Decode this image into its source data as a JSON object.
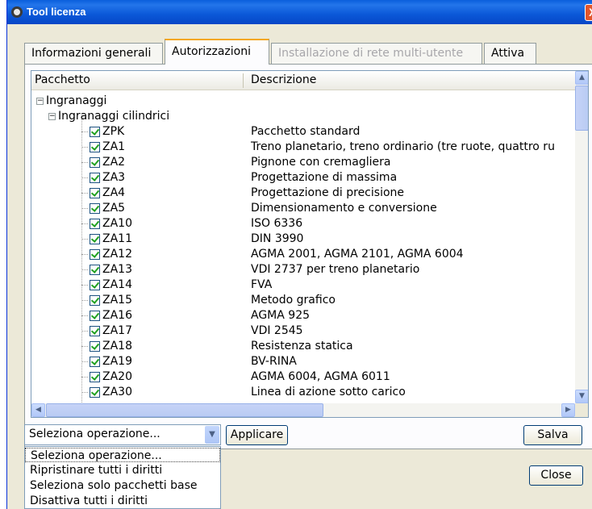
{
  "window": {
    "title": "Tool licenza",
    "close_glyph": "X"
  },
  "tabs": [
    {
      "label": "Informazioni generali",
      "state": "normal"
    },
    {
      "label": "Autorizzazioni",
      "state": "active"
    },
    {
      "label": "Installazione di rete multi-utente",
      "state": "disabled"
    },
    {
      "label": "Attiva",
      "state": "normal"
    }
  ],
  "grid": {
    "columns": [
      "Pacchetto",
      "Descrizione"
    ],
    "tree": {
      "root": "Ingranaggi",
      "child": "Ingranaggi cilindrici",
      "packages": [
        {
          "code": "ZPK",
          "description": "Pacchetto standard",
          "checked": true
        },
        {
          "code": "ZA1",
          "description": "Treno planetario, treno ordinario (tre ruote, quattro ru",
          "checked": true
        },
        {
          "code": "ZA2",
          "description": "Pignone con cremagliera",
          "checked": true
        },
        {
          "code": "ZA3",
          "description": "Progettazione di massima",
          "checked": true
        },
        {
          "code": "ZA4",
          "description": "Progettazione di precisione",
          "checked": true
        },
        {
          "code": "ZA5",
          "description": "Dimensionamento e conversione",
          "checked": true
        },
        {
          "code": "ZA10",
          "description": "ISO 6336",
          "checked": true
        },
        {
          "code": "ZA11",
          "description": "DIN 3990",
          "checked": true
        },
        {
          "code": "ZA12",
          "description": "AGMA 2001, AGMA 2101, AGMA 6004",
          "checked": true
        },
        {
          "code": "ZA13",
          "description": "VDI 2737 per treno planetario",
          "checked": true
        },
        {
          "code": "ZA14",
          "description": "FVA",
          "checked": true
        },
        {
          "code": "ZA15",
          "description": "Metodo grafico",
          "checked": true
        },
        {
          "code": "ZA16",
          "description": "AGMA 925",
          "checked": true
        },
        {
          "code": "ZA17",
          "description": "VDI 2545",
          "checked": true
        },
        {
          "code": "ZA18",
          "description": "Resistenza statica",
          "checked": true
        },
        {
          "code": "ZA19",
          "description": "BV-RINA",
          "checked": true
        },
        {
          "code": "ZA20",
          "description": "AGMA 6004, AGMA 6011",
          "checked": true
        },
        {
          "code": "ZA30",
          "description": "Linea di azione sotto carico",
          "checked": true
        }
      ]
    }
  },
  "actions": {
    "select_value": "Seleziona operazione...",
    "apply_label": "Applicare",
    "save_label": "Salva",
    "close_label": "Close"
  },
  "dropdown_options": [
    "Seleziona operazione...",
    "Ripristinare tutti i diritti",
    "Seleziona solo pacchetti base",
    "Disattiva tutti i diritti"
  ]
}
